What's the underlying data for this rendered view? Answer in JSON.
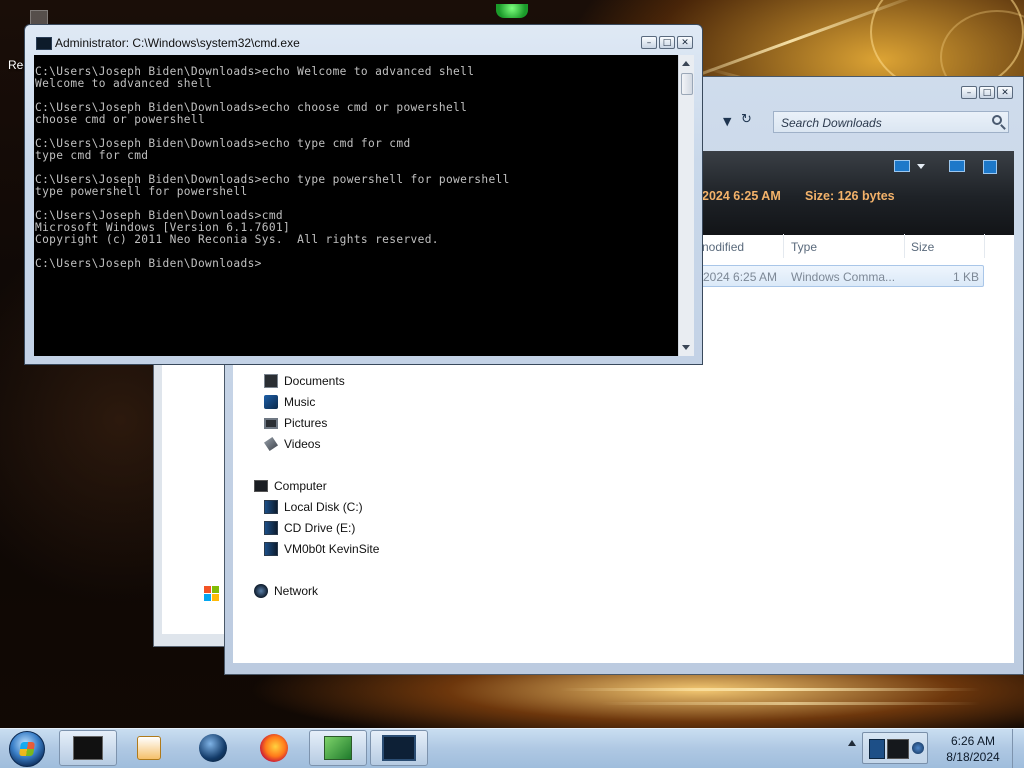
{
  "desktop": {
    "icon_label": "Rec"
  },
  "cmd": {
    "title": "Administrator: C:\\Windows\\system32\\cmd.exe",
    "lines": [
      "C:\\Users\\Joseph Biden\\Downloads>echo Welcome to advanced shell",
      "Welcome to advanced shell",
      "",
      "C:\\Users\\Joseph Biden\\Downloads>echo choose cmd or powershell",
      "choose cmd or powershell",
      "",
      "C:\\Users\\Joseph Biden\\Downloads>echo type cmd for cmd",
      "type cmd for cmd",
      "",
      "C:\\Users\\Joseph Biden\\Downloads>echo type powershell for powershell",
      "type powershell for powershell",
      "",
      "C:\\Users\\Joseph Biden\\Downloads>cmd",
      "Microsoft Windows [Version 6.1.7601]",
      "Copyright (c) 2011 Neo Reconia Sys.  All rights reserved.",
      "",
      "C:\\Users\\Joseph Biden\\Downloads>"
    ]
  },
  "explorer": {
    "search_placeholder": "Search Downloads",
    "details": {
      "modified": "2024 6:25 AM",
      "size": "Size: 126 bytes"
    },
    "columns": {
      "modified": "nodified",
      "type": "Type",
      "size": "Size"
    },
    "file": {
      "modified": "2024 6:25 AM",
      "type": "Windows Comma...",
      "size": "1 KB"
    },
    "nav": {
      "documents": "Documents",
      "music": "Music",
      "pictures": "Pictures",
      "videos": "Videos",
      "computer": "Computer",
      "local_disk": "Local Disk (C:)",
      "cd_drive": "CD Drive (E:)",
      "vm_share": "VM0b0t KevinSite",
      "network": "Network"
    }
  },
  "taskbar": {
    "buttons": [
      "cmd-window",
      "media-player",
      "globe-app",
      "firefox",
      "explorer-app",
      "terminal-app"
    ],
    "clock_time": "6:26 AM",
    "clock_date": "8/18/2024"
  },
  "colors": {
    "console_bg": "#000000",
    "console_text": "#c0c0c0",
    "details_accent": "#f3b26a",
    "taskbar": "#afc8e3"
  }
}
